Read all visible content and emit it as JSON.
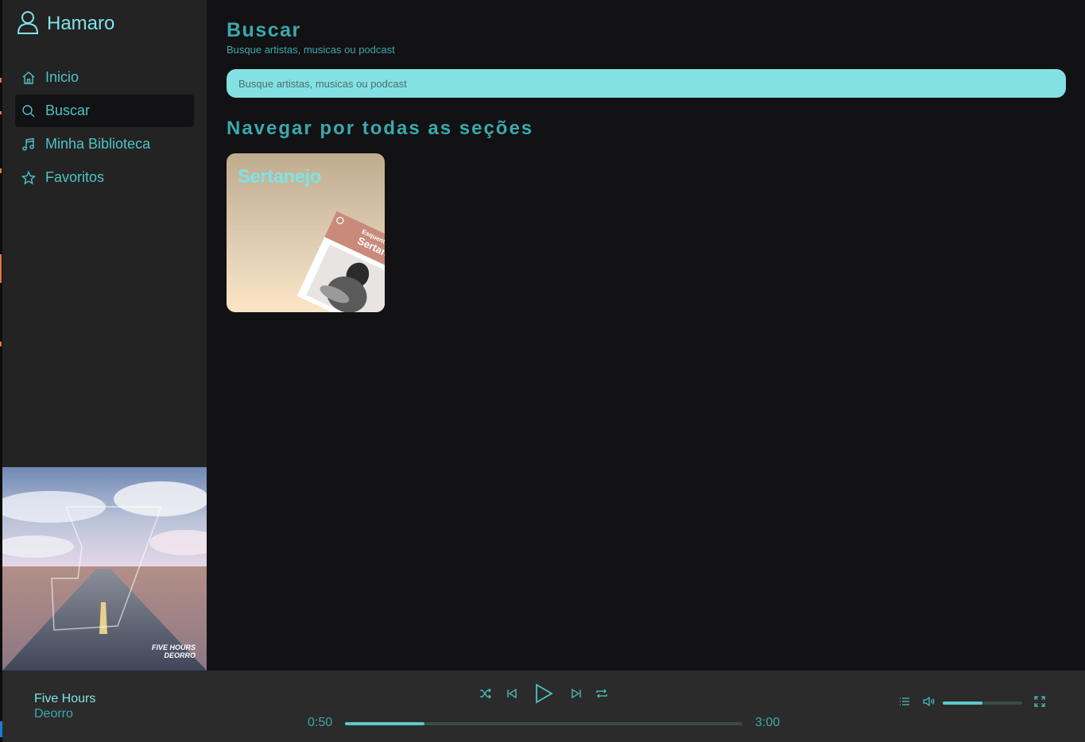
{
  "app": {
    "user_name": "Hamaro"
  },
  "sidebar": {
    "items": [
      {
        "label": "Inicio",
        "icon": "home-icon",
        "active": false
      },
      {
        "label": "Buscar",
        "icon": "search-icon",
        "active": true
      },
      {
        "label": "Minha Biblioteca",
        "icon": "music-note-icon",
        "active": false
      },
      {
        "label": "Favoritos",
        "icon": "star-icon",
        "active": false
      }
    ]
  },
  "main": {
    "title": "Buscar",
    "subtitle": "Busque artistas, musicas ou podcast",
    "search_placeholder": "Busque artistas, musicas ou podcast",
    "section_title": "Navegar por todas as seções",
    "genres": [
      {
        "name": "Sertanejo",
        "cover_line1": "Esquenta",
        "cover_line2": "Sertanejo"
      }
    ]
  },
  "album_art": {
    "line1": "FIVE HOURS",
    "line2": "DEORRO"
  },
  "player": {
    "track_title": "Five Hours",
    "track_artist": "Deorro",
    "current_time": "0:50",
    "total_time": "3:00",
    "progress_fraction": 0.2,
    "volume_fraction": 0.5
  },
  "colors": {
    "accent": "#7fe3e6",
    "accent_dark": "#3aa9ad",
    "search_bg": "#84e1e3",
    "sidebar_bg": "#232323",
    "main_bg": "#121113",
    "player_bg": "#2b2b2b"
  }
}
